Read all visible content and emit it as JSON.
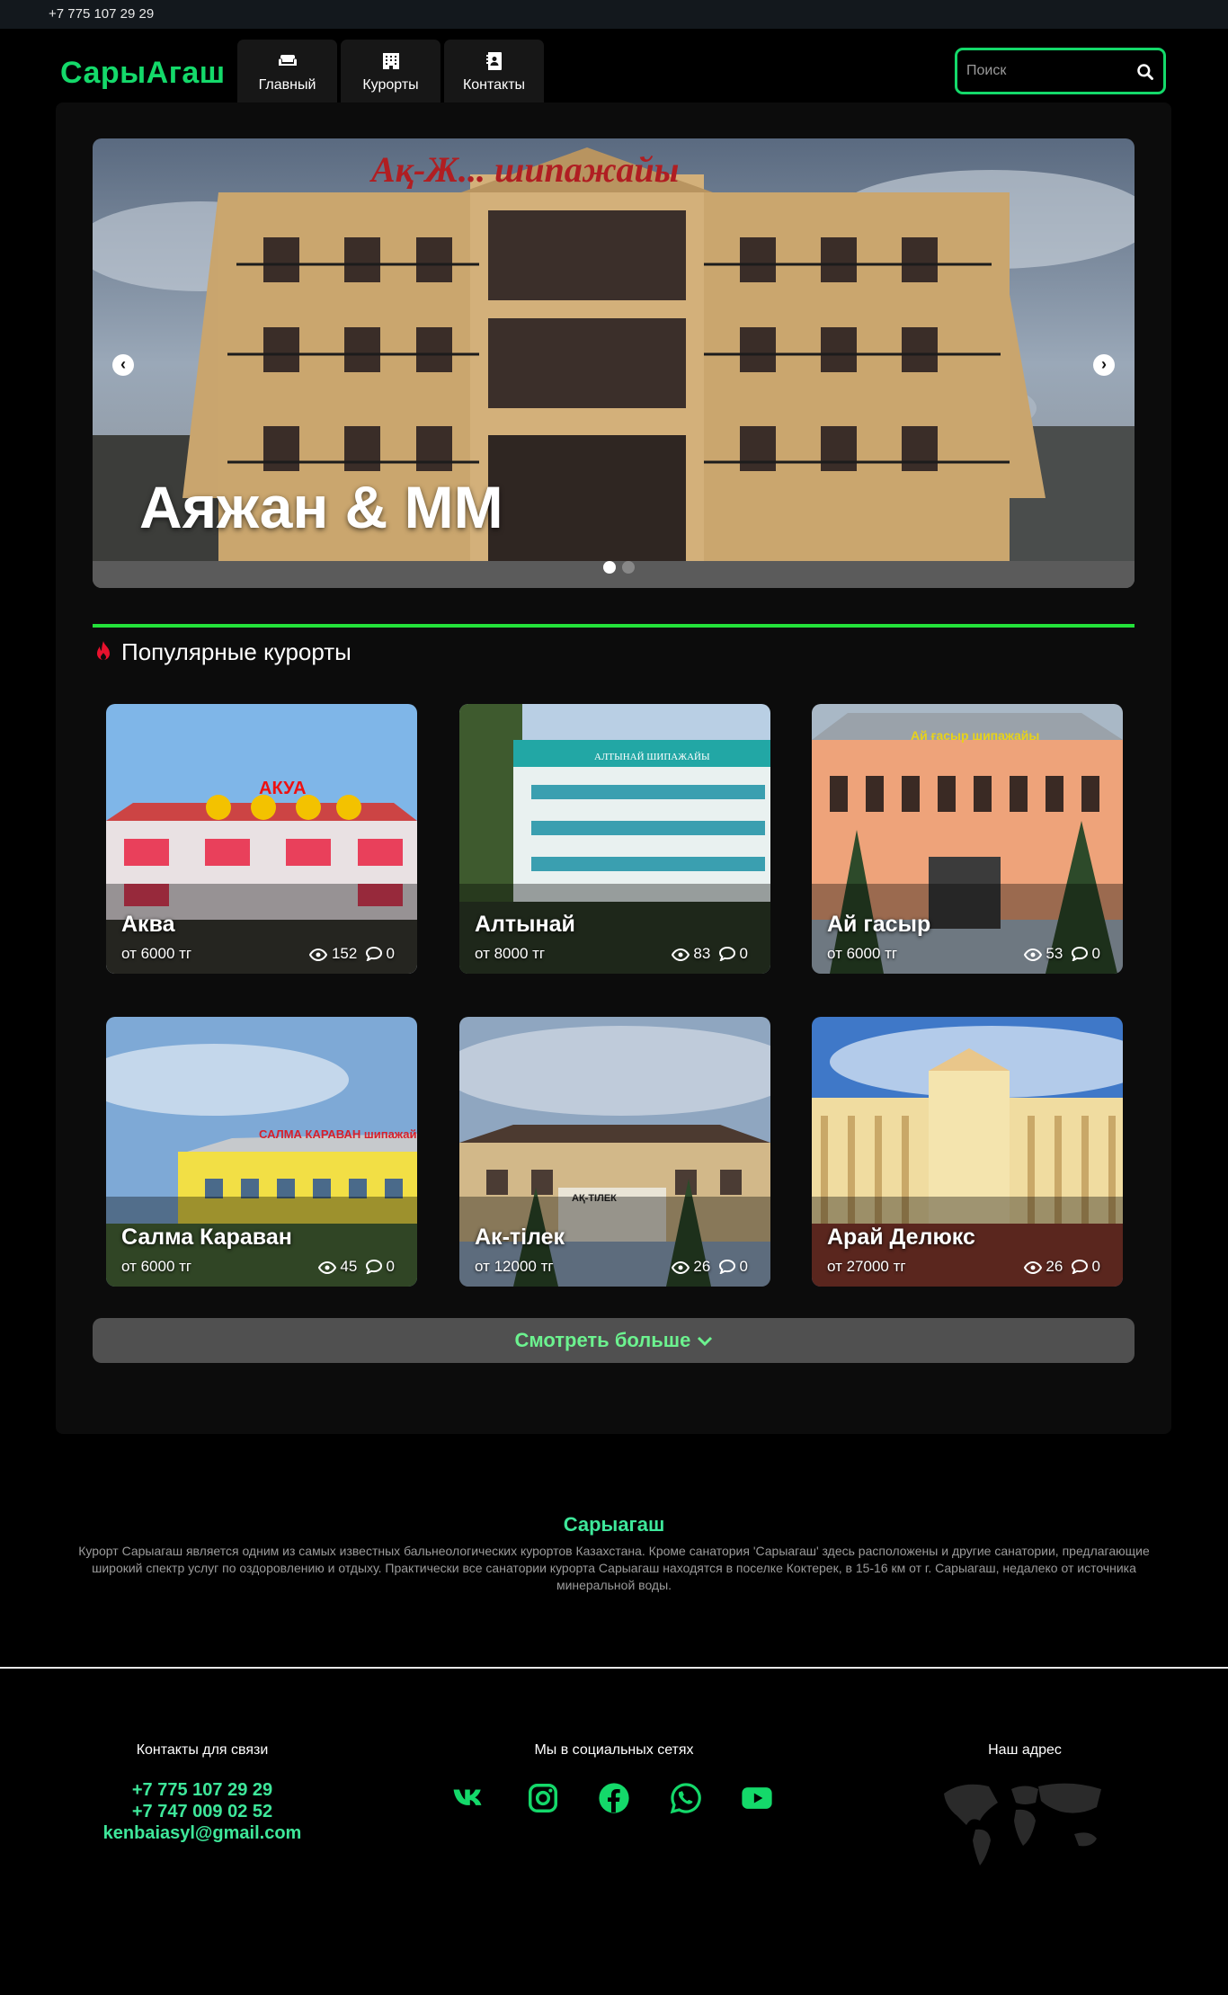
{
  "topbar": {
    "phone": "+7 775 107 29 29"
  },
  "header": {
    "logo": "СарыАгаш",
    "nav": [
      {
        "label": "Главный",
        "icon": "sofa-icon"
      },
      {
        "label": "Курорты",
        "icon": "hotel-icon"
      },
      {
        "label": "Контакты",
        "icon": "contact-book-icon"
      }
    ],
    "search": {
      "placeholder": "Поиск",
      "icon": "search-icon"
    }
  },
  "slider": {
    "title": "Аяжан & ММ",
    "slides": 2,
    "active": 1,
    "sign_text": "Ақ-Ж... шипажайы"
  },
  "popular": {
    "title": "Популярные курорты",
    "icon": "fire-icon",
    "cards": [
      {
        "name": "Аква",
        "price": "от 6000 тг",
        "views": "152",
        "comments": "0",
        "sign": "АКУА"
      },
      {
        "name": "Алтынай",
        "price": "от 8000 тг",
        "views": "83",
        "comments": "0",
        "sign": "АЛТЫНАЙ ШИПАЖАЙЫ"
      },
      {
        "name": "Ай гасыр",
        "price": "от 6000 тг",
        "views": "53",
        "comments": "0",
        "sign": "Ай ғасыр шипажайы"
      },
      {
        "name": "Салма Караван",
        "price": "от 6000 тг",
        "views": "45",
        "comments": "0",
        "sign": "САЛМА КАРАВАН шипажайы"
      },
      {
        "name": "Ак-тілек",
        "price": "от 12000 тг",
        "views": "26",
        "comments": "0",
        "sign": "АҚ-ТІЛЕК"
      },
      {
        "name": "Арай Делюкс",
        "price": "от 27000 тг",
        "views": "26",
        "comments": "0",
        "sign": ""
      }
    ],
    "more_label": "Смотреть больше"
  },
  "about": {
    "title": "Сарыагаш",
    "text": "Курорт Сарыагаш является одним из самых известных бальнеологических курортов Казахстана. Кроме санатория 'Сарыагаш' здесь расположены и другие санатории, предлагающие широкий спектр услуг по оздоровлению и отдыху. Практически все санатории курорта Сарыагаш находятся в поселке Коктерек, в 15-16 км от г. Сарыагаш, недалеко от источника минеральной воды."
  },
  "footer": {
    "contacts_title": "Контакты для связи",
    "phone1": "+7 775 107 29 29",
    "phone2": "+7 747 009 02 52",
    "email": "kenbaiasyl@gmail.com",
    "social_title": "Мы в социальных сетях",
    "social": [
      "vk-icon",
      "instagram-icon",
      "facebook-icon",
      "whatsapp-icon",
      "youtube-icon"
    ],
    "address_title": "Наш адрес"
  },
  "colors": {
    "accent": "#14d96a",
    "link": "#3ee79a",
    "divider": "#24e23a"
  }
}
